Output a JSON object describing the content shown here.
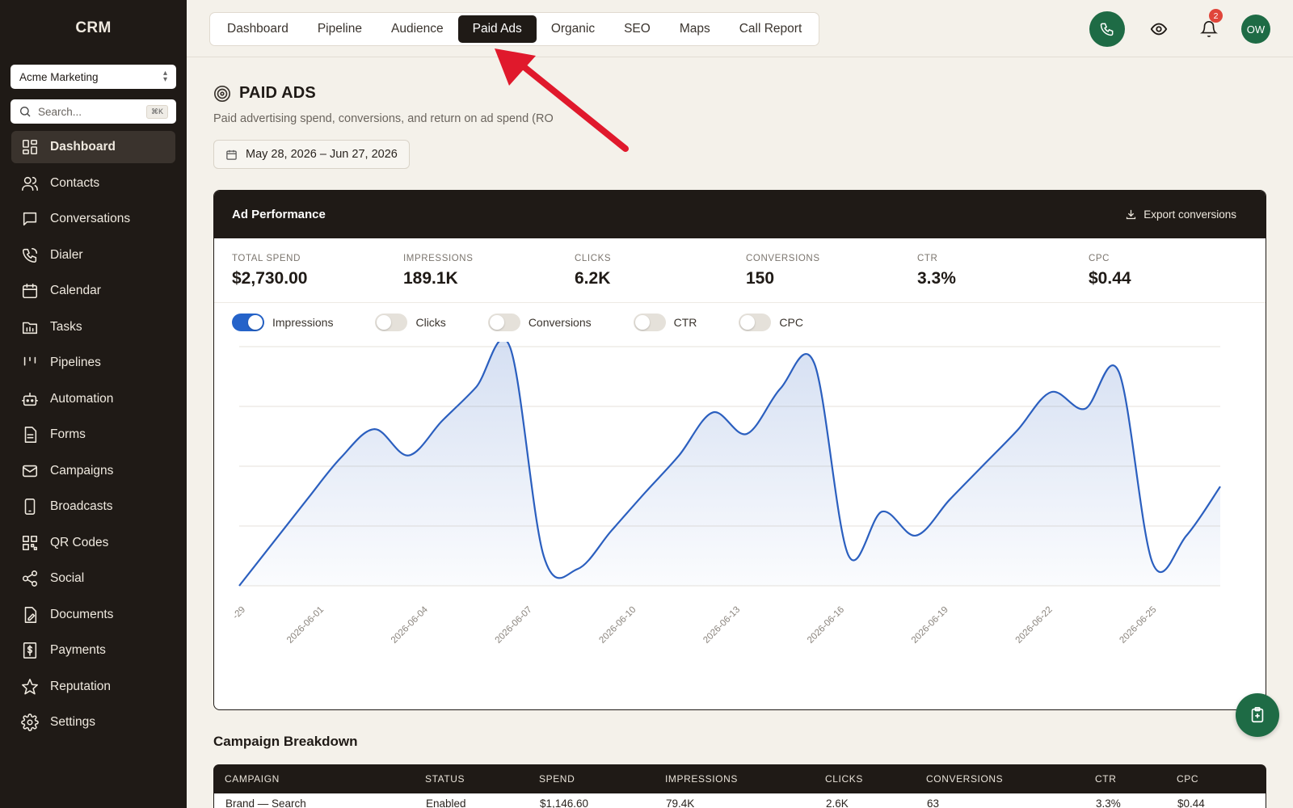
{
  "app": {
    "brand": "CRM"
  },
  "sidebar": {
    "org_selector": "Acme Marketing",
    "search": {
      "placeholder": "Search...",
      "shortcut": "⌘K"
    },
    "items": [
      {
        "label": "Dashboard",
        "icon": "dashboard-icon",
        "active": true
      },
      {
        "label": "Contacts",
        "icon": "contacts-icon"
      },
      {
        "label": "Conversations",
        "icon": "conversations-icon"
      },
      {
        "label": "Dialer",
        "icon": "dialer-icon"
      },
      {
        "label": "Calendar",
        "icon": "calendar-icon"
      },
      {
        "label": "Tasks",
        "icon": "tasks-icon"
      },
      {
        "label": "Pipelines",
        "icon": "pipelines-icon"
      },
      {
        "label": "Automation",
        "icon": "automation-icon"
      },
      {
        "label": "Forms",
        "icon": "forms-icon"
      },
      {
        "label": "Campaigns",
        "icon": "campaigns-icon"
      },
      {
        "label": "Broadcasts",
        "icon": "broadcasts-icon"
      },
      {
        "label": "QR Codes",
        "icon": "qr-codes-icon"
      },
      {
        "label": "Social",
        "icon": "social-icon"
      },
      {
        "label": "Documents",
        "icon": "documents-icon"
      },
      {
        "label": "Payments",
        "icon": "payments-icon"
      },
      {
        "label": "Reputation",
        "icon": "reputation-icon"
      },
      {
        "label": "Settings",
        "icon": "settings-icon"
      }
    ]
  },
  "topbar": {
    "tabs": [
      {
        "label": "Dashboard"
      },
      {
        "label": "Pipeline"
      },
      {
        "label": "Audience"
      },
      {
        "label": "Paid Ads",
        "active": true
      },
      {
        "label": "Organic"
      },
      {
        "label": "SEO"
      },
      {
        "label": "Maps"
      },
      {
        "label": "Call Report"
      }
    ],
    "notifications_count": "2",
    "avatar_initials": "OW"
  },
  "page": {
    "title": "PAID ADS",
    "description": "Paid advertising spend, conversions, and return on ad spend (RO",
    "date_range": "May 28, 2026 – Jun 27, 2026"
  },
  "card": {
    "title": "Ad Performance",
    "export_label": "Export conversions",
    "stats": [
      {
        "label": "TOTAL SPEND",
        "value": "$2,730.00"
      },
      {
        "label": "IMPRESSIONS",
        "value": "189.1K"
      },
      {
        "label": "CLICKS",
        "value": "6.2K"
      },
      {
        "label": "CONVERSIONS",
        "value": "150"
      },
      {
        "label": "CTR",
        "value": "3.3%"
      },
      {
        "label": "CPC",
        "value": "$0.44"
      }
    ],
    "toggles": [
      {
        "label": "Impressions",
        "on": true
      },
      {
        "label": "Clicks",
        "on": false
      },
      {
        "label": "Conversions",
        "on": false
      },
      {
        "label": "CTR",
        "on": false
      },
      {
        "label": "CPC",
        "on": false
      }
    ]
  },
  "chart_data": {
    "type": "area",
    "series": [
      {
        "color": "#2b5fbf",
        "x": [
          "2026-05-29",
          "2026-05-30",
          "2026-05-31",
          "2026-06-01",
          "2026-06-02",
          "2026-06-03",
          "2026-06-04",
          "2026-06-05",
          "2026-06-06",
          "2026-06-07",
          "2026-06-08",
          "2026-06-09",
          "2026-06-10",
          "2026-06-11",
          "2026-06-12",
          "2026-06-13",
          "2026-06-14",
          "2026-06-15",
          "2026-06-16",
          "2026-06-17",
          "2026-06-18",
          "2026-06-19",
          "2026-06-20",
          "2026-06-21",
          "2026-06-22",
          "2026-06-23",
          "2026-06-24",
          "2026-06-25",
          "2026-06-26",
          "2026-06-27"
        ],
        "values": [
          0,
          3.6,
          7.2,
          10.7,
          13.1,
          10.9,
          13.8,
          16.6,
          20,
          2.5,
          1.4,
          4.6,
          7.8,
          10.9,
          14.5,
          12.7,
          16.5,
          18.6,
          2.6,
          6.2,
          4.2,
          7.2,
          10.1,
          13,
          16.2,
          14.8,
          17.9,
          1.9,
          4.2,
          8.3
        ]
      }
    ],
    "xlabels": [
      "-29",
      "2026-06-01",
      "2026-06-04",
      "2026-06-07",
      "2026-06-10",
      "2026-06-13",
      "2026-06-16",
      "2026-06-19",
      "2026-06-22",
      "2026-06-25"
    ],
    "ylim": [
      0,
      20
    ],
    "grid": true,
    "legend": "none"
  },
  "campaigns": {
    "title": "Campaign Breakdown",
    "columns": [
      "CAMPAIGN",
      "STATUS",
      "SPEND",
      "IMPRESSIONS",
      "CLICKS",
      "CONVERSIONS",
      "CTR",
      "CPC"
    ],
    "rows": [
      [
        "Brand — Search",
        "Enabled",
        "$1,146.60",
        "79.4K",
        "2.6K",
        "63",
        "3.3%",
        "$0.44"
      ]
    ]
  }
}
